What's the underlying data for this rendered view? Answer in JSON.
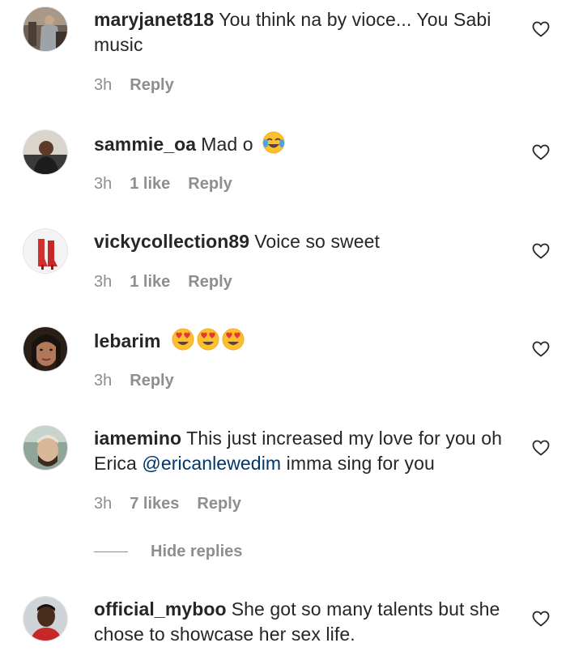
{
  "comments": [
    {
      "username": "maryjanet818",
      "text": "You think na by vioce... You Sabi music",
      "time": "3h",
      "likes": "",
      "reply_label": "Reply",
      "avatar": "avatar-woman-grey-dress"
    },
    {
      "username": "sammie_oa",
      "text": "Mad o",
      "emoji": [
        "face-with-tears-of-joy"
      ],
      "time": "3h",
      "likes": "1 like",
      "reply_label": "Reply",
      "avatar": "avatar-man-car"
    },
    {
      "username": "vickycollection89",
      "text": "Voice so sweet",
      "time": "3h",
      "likes": "1 like",
      "reply_label": "Reply",
      "avatar": "avatar-red-boots"
    },
    {
      "username": "lebarim",
      "text": "",
      "emoji": [
        "heart-eyes",
        "heart-eyes",
        "heart-eyes"
      ],
      "time": "3h",
      "likes": "",
      "reply_label": "Reply",
      "avatar": "avatar-woman-portrait"
    },
    {
      "username": "iamemino",
      "text_before": "This just increased my love for you oh Erica",
      "mention": "@ericanlewedim",
      "text_after": "imma sing for you",
      "time": "3h",
      "likes": "7 likes",
      "reply_label": "Reply",
      "avatar": "avatar-man-beard"
    },
    {
      "username": "official_myboo",
      "text": "She got so many talents but she chose to showcase her sex life.",
      "avatar": "avatar-man-red-shirt"
    }
  ],
  "hide_replies_label": "Hide replies",
  "colors": {
    "text": "#262626",
    "meta": "#8e8e8e",
    "mention": "#00376b",
    "emoji_face": "#fbc02d",
    "heart_eyes": "#e53935"
  }
}
